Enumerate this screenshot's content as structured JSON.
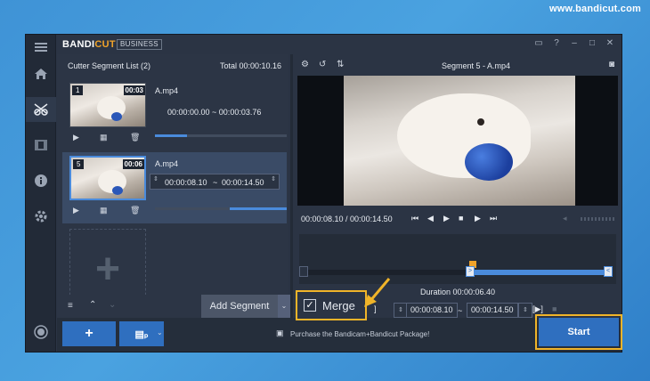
{
  "watermark": "www.bandicut.com",
  "brand": {
    "name_left": "BANDI",
    "name_right": "CUT",
    "edition": "BUSINESS"
  },
  "colors": {
    "accent": "#2f6fbf",
    "highlight": "#f0b429",
    "brand_orange": "#f0a32a",
    "bg": "#2b3444"
  },
  "nav": {
    "items": [
      "menu-icon",
      "home-icon",
      "cut-icon",
      "film-icon",
      "info-icon",
      "gear-icon",
      "record-icon"
    ],
    "active": "cut-icon"
  },
  "titlebar": {
    "icons": [
      "folder-icon",
      "help-icon",
      "minimize-icon",
      "maximize-icon",
      "close-icon"
    ]
  },
  "segment_list": {
    "title": "Cutter Segment List (2)",
    "total": "Total 00:00:10.16",
    "segments": [
      {
        "index": "1",
        "duration": "00:03",
        "filename": "A.mp4",
        "range": "00:00:00.00 ~ 00:00:03.76",
        "progress": 0.25,
        "selected": false
      },
      {
        "index": "5",
        "duration": "00:06",
        "filename": "A.mp4",
        "start": "00:00:08.10",
        "tilde": "~",
        "end": "00:00:14.50",
        "progress": 0.55,
        "selected": true
      }
    ],
    "add_segment": "Add Segment"
  },
  "player": {
    "title": "Segment 5 - A.mp4",
    "timecode": "00:00:08.10 / 00:00:14.50",
    "duration": "Duration 00:00:06.40",
    "start": "00:00:08.10",
    "tilde": "~",
    "end": "00:00:14.50"
  },
  "merge": {
    "label": "Merge",
    "checked": true
  },
  "promo": "Purchase the Bandicam+Bandicut Package!",
  "start_button": "Start"
}
